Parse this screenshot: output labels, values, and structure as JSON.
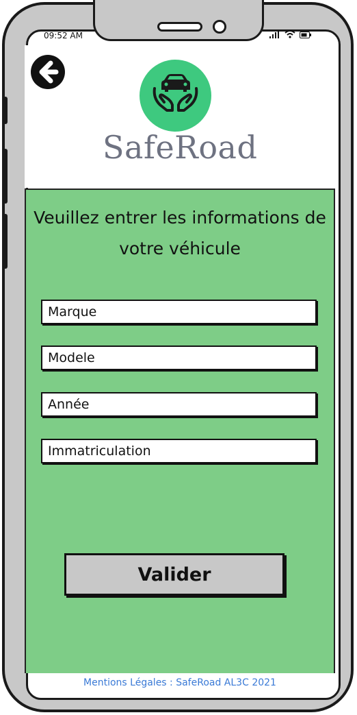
{
  "status_bar": {
    "time": "09:52 AM"
  },
  "header": {
    "back_icon": "arrow-left-circle-icon",
    "logo_icon": "car-hands-icon",
    "brand_name": "SafeRoad",
    "logo_color": "#3ec97f"
  },
  "form": {
    "title": "Veuillez entrer les informations de votre véhicule",
    "fields": [
      {
        "placeholder": "Marque"
      },
      {
        "placeholder": "Modele"
      },
      {
        "placeholder": "Année"
      },
      {
        "placeholder": "Immatriculation"
      }
    ],
    "submit_label": "Valider",
    "background_color": "#7ecd87"
  },
  "footer": {
    "text": "Mentions Légales : SafeRoad AL3C 2021",
    "link_color": "#3a7ad6"
  }
}
